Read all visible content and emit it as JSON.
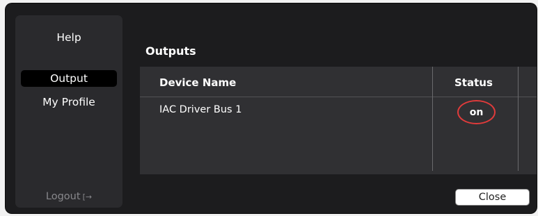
{
  "sidebar": {
    "items": [
      {
        "label": "Help",
        "active": false
      },
      {
        "label": "Output",
        "active": true
      },
      {
        "label": "My Profile",
        "active": false
      }
    ],
    "logout_label": "Logout",
    "logout_icon": "logout-icon"
  },
  "main": {
    "title": "Outputs",
    "table": {
      "columns": [
        "Device Name",
        "Status"
      ],
      "rows": [
        {
          "device_name": "IAC Driver Bus 1",
          "status": "on"
        }
      ]
    }
  },
  "footer": {
    "close_label": "Close"
  },
  "colors": {
    "window_bg": "#1c1c1e",
    "sidebar_bg": "#2a2a2d",
    "table_bg": "#303033",
    "status_highlight": "#e03b3b"
  }
}
